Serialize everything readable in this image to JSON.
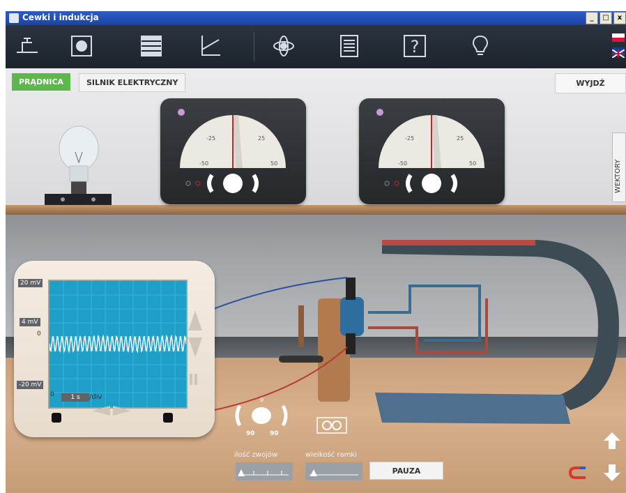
{
  "window": {
    "title": "Cewki i indukcja",
    "buttons": [
      "_",
      "□",
      "x"
    ]
  },
  "toolbar": {
    "icons": [
      "circuit-icon",
      "gear-icon",
      "table-icon",
      "graph-icon",
      "atom-icon",
      "document-icon",
      "help-icon",
      "bulb-icon"
    ],
    "help_label": "?"
  },
  "tabs": {
    "generator": "PRĄDNICA",
    "motor": "SILNIK ELEKTRYCZNY",
    "exit": "WYJDŹ",
    "vectors": "WEKTORY"
  },
  "meters": {
    "scale_labels": [
      "-50",
      "-25",
      "25",
      "50"
    ],
    "left_value": 0,
    "right_value": 0
  },
  "oscilloscope": {
    "range_top": "20 mV",
    "range_mid": "4 mV",
    "range_bottom": "-20 mV",
    "zero_left": "0",
    "zero_bottom": "0",
    "time_div": "1 s",
    "div_label": "/div"
  },
  "crank": {
    "top_label": "0",
    "left_label": "90",
    "right_label": "90"
  },
  "controls": {
    "turns_label": "ilość zwojów",
    "frame_size_label": "wielkość ramki",
    "pause_label": "PAUZA"
  },
  "colors": {
    "accent_green": "#5cb84a",
    "screen_blue": "#1e9fc8",
    "wire_blue": "#2c4f9e",
    "wire_red": "#b83a32"
  }
}
